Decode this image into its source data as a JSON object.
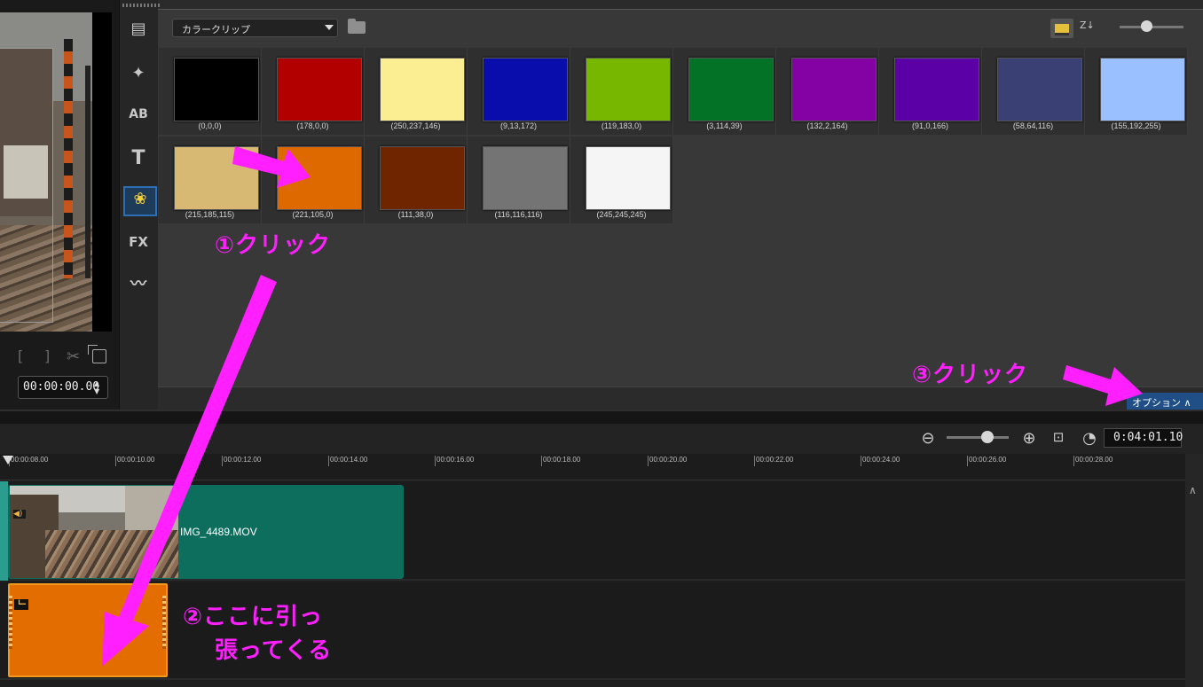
{
  "library": {
    "folder_select": "カラークリップ",
    "colors_row1": [
      {
        "hex": "#000000",
        "label": "(0,0,0)"
      },
      {
        "hex": "#b20000",
        "label": "(178,0,0)"
      },
      {
        "hex": "#faed92",
        "label": "(250,237,146)"
      },
      {
        "hex": "#090dac",
        "label": "(9,13,172)"
      },
      {
        "hex": "#77b700",
        "label": "(119,183,0)"
      },
      {
        "hex": "#037227",
        "label": "(3,114,39)"
      },
      {
        "hex": "#8402a4",
        "label": "(132,2,164)"
      },
      {
        "hex": "#5b00a6",
        "label": "(91,0,166)"
      },
      {
        "hex": "#3a4074",
        "label": "(58,64,116)"
      },
      {
        "hex": "#9bc0ff",
        "label": "(155,192,255)"
      }
    ],
    "colors_row2": [
      {
        "hex": "#d7b973",
        "label": "(215,185,115)"
      },
      {
        "hex": "#dd6900",
        "label": "(221,105,0)"
      },
      {
        "hex": "#6f2600",
        "label": "(111,38,0)"
      },
      {
        "hex": "#747474",
        "label": "(116,116,116)"
      },
      {
        "hex": "#f5f5f5",
        "label": "(245,245,245)"
      }
    ],
    "options_button": "オプション ∧"
  },
  "preview": {
    "timecode": "00:00:00.00"
  },
  "timeline": {
    "timecode": "0:04:01.10",
    "ruler": [
      "00:00:08.00",
      "00:00:10.00",
      "00:00:12.00",
      "00:00:14.00",
      "00:00:16.00",
      "00:00:18.00",
      "00:00:20.00",
      "00:00:22.00",
      "00:00:24.00",
      "00:00:26.00",
      "00:00:28.00"
    ],
    "video_clip_name": "IMG_4489.MOV",
    "color_clip_hex": "#e36d00"
  },
  "annotations": {
    "step1": "①クリック",
    "step2_line1": "②ここに引っ",
    "step2_line2": "張ってくる",
    "step3": "③クリック",
    "color": "#ff1fff"
  }
}
